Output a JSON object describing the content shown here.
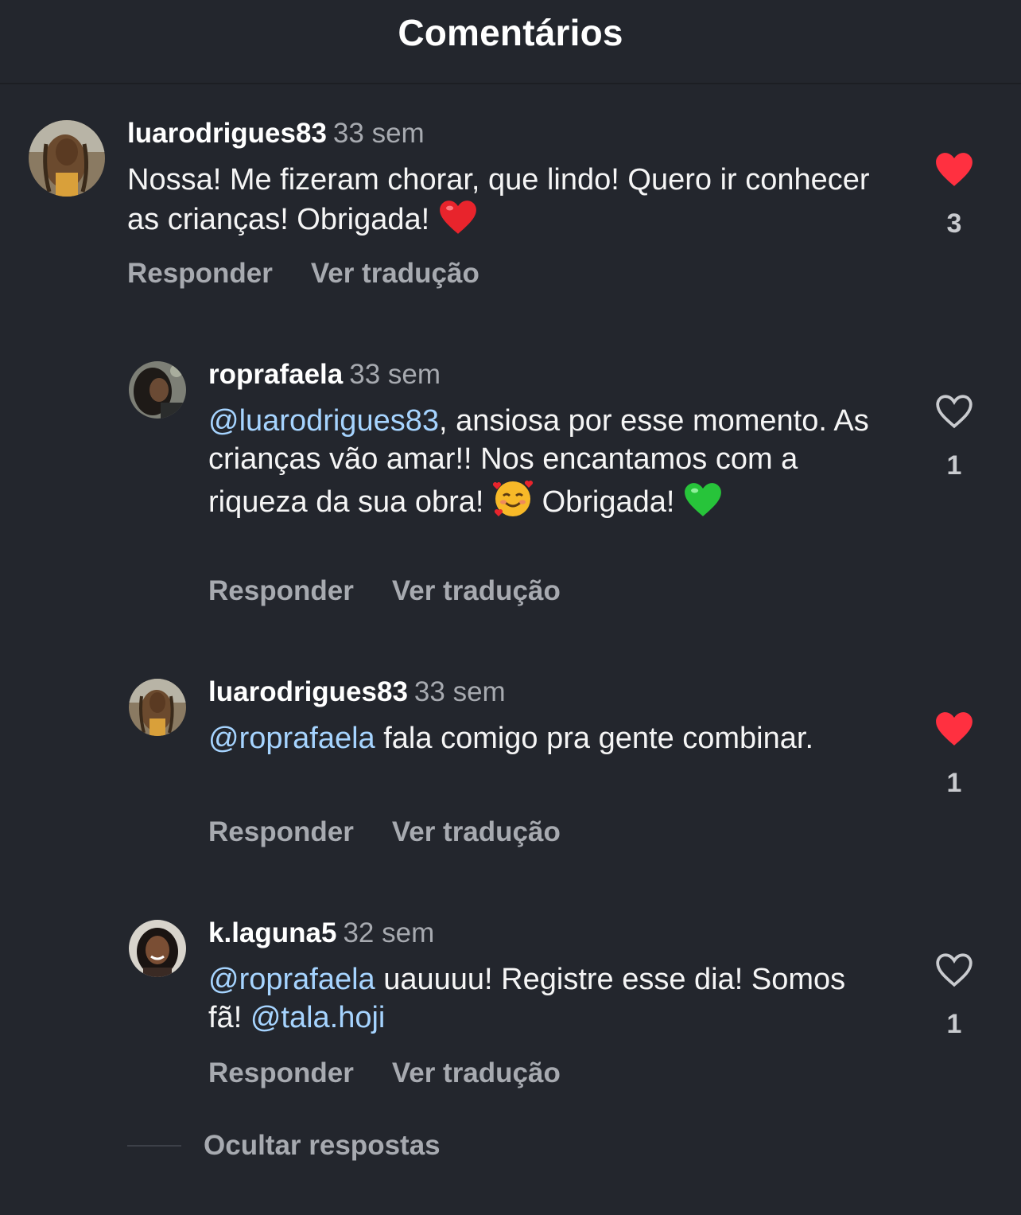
{
  "header": {
    "title": "Comentários"
  },
  "comments": [
    {
      "username": "luarodrigues83",
      "time": "33 sem",
      "text_a": "Nossa! Me fizeram chorar, que lindo! Quero ir conhecer as crianças! Obrigada! ",
      "liked": true,
      "like_count": "3",
      "reply_label": "Responder",
      "translate_label": "Ver tradução"
    },
    {
      "username": "roprafaela",
      "time": "33 sem",
      "mention": "@luarodrigues83",
      "text_a": ", ansiosa por esse momento. As crianças vão amar!! Nos encantamos com a riqueza da sua obra! ",
      "text_b": " Obrigada! ",
      "liked": false,
      "like_count": "1",
      "reply_label": "Responder",
      "translate_label": "Ver tradução"
    },
    {
      "username": "luarodrigues83",
      "time": "33 sem",
      "mention": "@roprafaela",
      "text_a": " fala comigo pra gente combinar.",
      "liked": true,
      "like_count": "1",
      "reply_label": "Responder",
      "translate_label": "Ver tradução"
    },
    {
      "username": "k.laguna5",
      "time": "32 sem",
      "mention": "@roprafaela",
      "text_a": " uauuuu! Registre esse dia! Somos fã! ",
      "mention_2": "@tala.hoji",
      "liked": false,
      "like_count": "1",
      "reply_label": "Responder",
      "translate_label": "Ver tradução"
    }
  ],
  "hide_replies_label": "Ocultar respostas",
  "colors": {
    "background": "#23262d",
    "mention": "#a6d4ff",
    "like_active": "#ff3040",
    "muted_text": "#a7aab0"
  }
}
